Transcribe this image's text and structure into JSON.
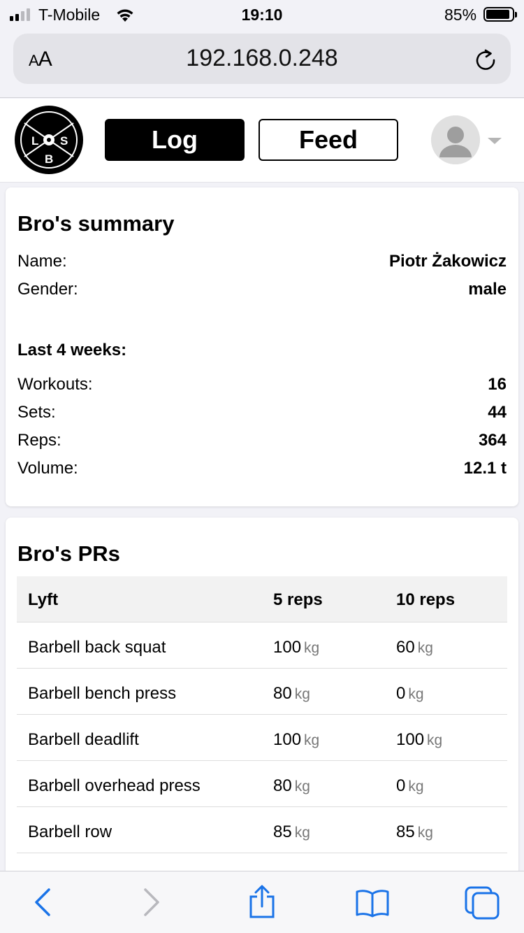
{
  "status_bar": {
    "carrier": "T-Mobile",
    "time": "19:10",
    "battery_percent": "85%"
  },
  "browser": {
    "text_size_label_small": "A",
    "text_size_label_large": "A",
    "url": "192.168.0.248"
  },
  "header": {
    "logo_letters": {
      "left": "L",
      "right": "S",
      "bottom": "B"
    },
    "log_label": "Log",
    "feed_label": "Feed"
  },
  "summary": {
    "title": "Bro's summary",
    "name_label": "Name:",
    "name_value": "Piotr Żakowicz",
    "gender_label": "Gender:",
    "gender_value": "male",
    "period_title": "Last 4 weeks:",
    "workouts_label": "Workouts:",
    "workouts_value": "16",
    "sets_label": "Sets:",
    "sets_value": "44",
    "reps_label": "Reps:",
    "reps_value": "364",
    "volume_label": "Volume:",
    "volume_value": "12.1 t"
  },
  "prs": {
    "title": "Bro's PRs",
    "columns": [
      "Lyft",
      "5 reps",
      "10 reps"
    ],
    "unit": "kg",
    "rows": [
      {
        "lift": "Barbell back squat",
        "five": "100",
        "ten": "60"
      },
      {
        "lift": "Barbell bench press",
        "five": "80",
        "ten": "0"
      },
      {
        "lift": "Barbell deadlift",
        "five": "100",
        "ten": "100"
      },
      {
        "lift": "Barbell overhead press",
        "five": "80",
        "ten": "0"
      },
      {
        "lift": "Barbell row",
        "five": "85",
        "ten": "85"
      }
    ]
  },
  "toolbar": {
    "icons": [
      "back-icon",
      "forward-icon",
      "share-icon",
      "bookmarks-icon",
      "tabs-icon"
    ]
  },
  "colors": {
    "accent": "#1a73e8",
    "disabled": "#b8b8bd",
    "unit_gray": "#777777"
  }
}
